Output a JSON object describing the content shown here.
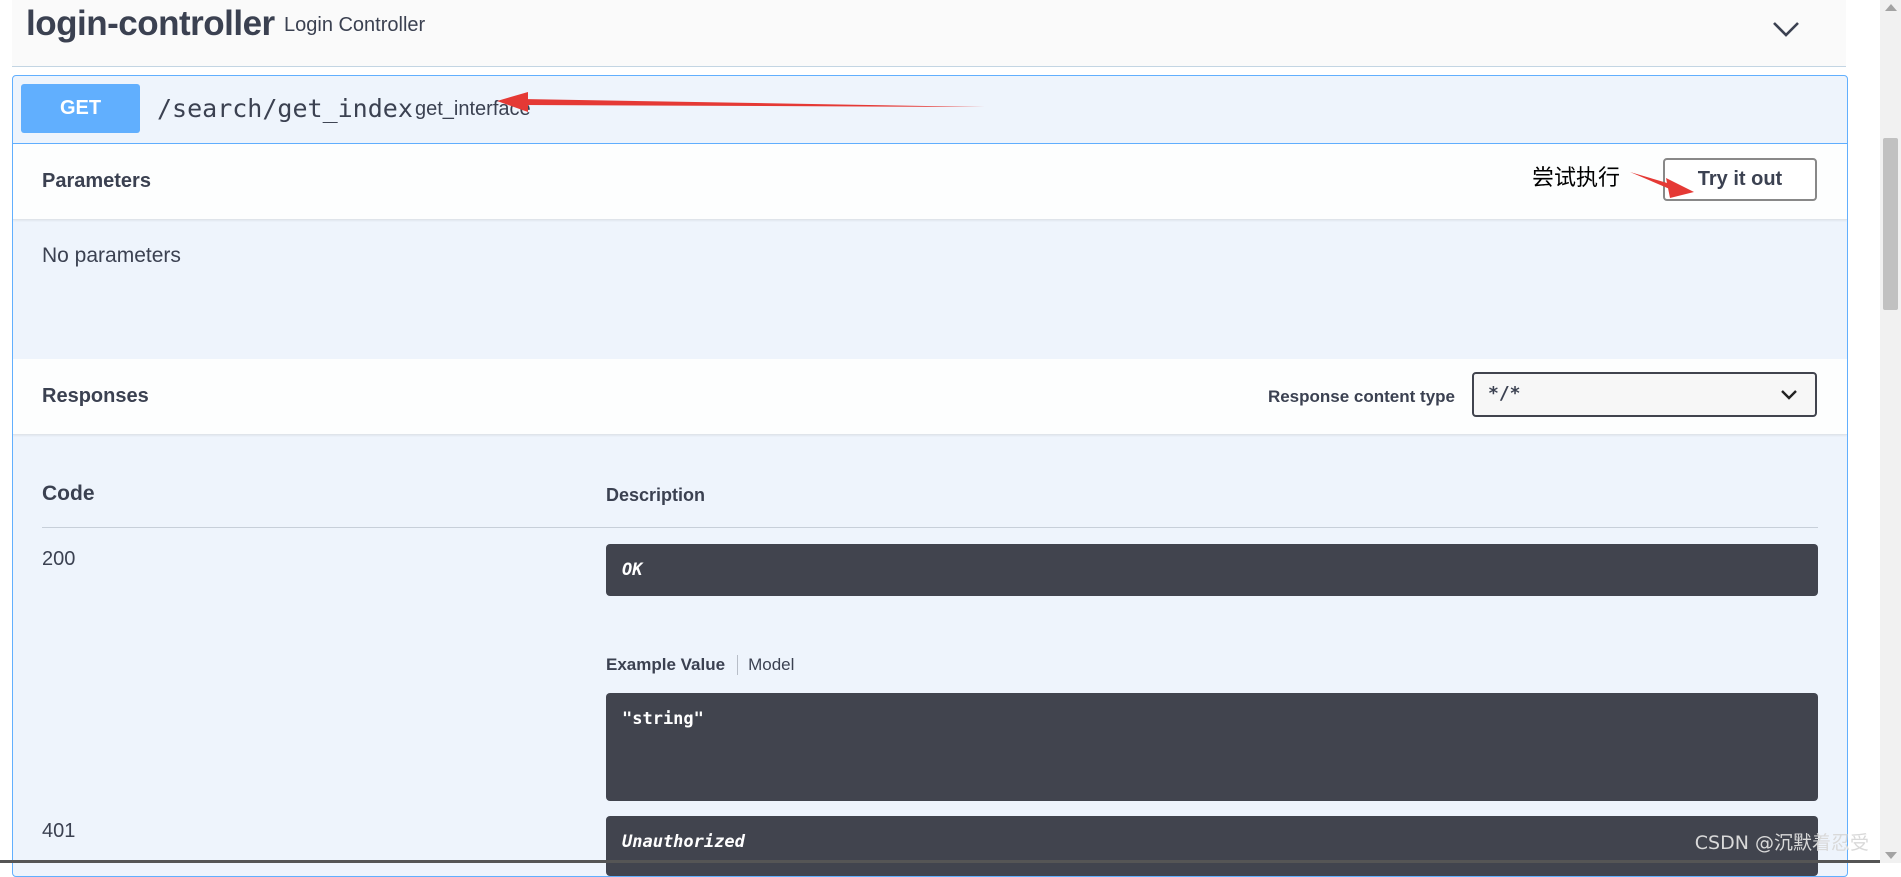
{
  "tag": {
    "name": "login-controller",
    "description": "Login Controller"
  },
  "operation": {
    "method": "GET",
    "path": "/search/get_index",
    "summary": "get_interface"
  },
  "parameters": {
    "title": "Parameters",
    "try_label": "Try it out",
    "empty_text": "No parameters"
  },
  "annotation": {
    "try_note": "尝试执行",
    "arrow_color": "#e53935"
  },
  "responses": {
    "title": "Responses",
    "content_type_label": "Response content type",
    "content_type_value": "*/*",
    "col_code": "Code",
    "col_description": "Description",
    "rows": [
      {
        "code": "200",
        "description": "OK",
        "example_tab": "Example Value",
        "model_tab": "Model",
        "example": "\"string\""
      },
      {
        "code": "401",
        "description": "Unauthorized"
      }
    ]
  },
  "watermark": "CSDN @沉默着忍受",
  "colors": {
    "get_blue": "#61affe",
    "opblock_bg": "#eef4fc",
    "dark_box": "#41444e",
    "text": "#3b4151"
  }
}
